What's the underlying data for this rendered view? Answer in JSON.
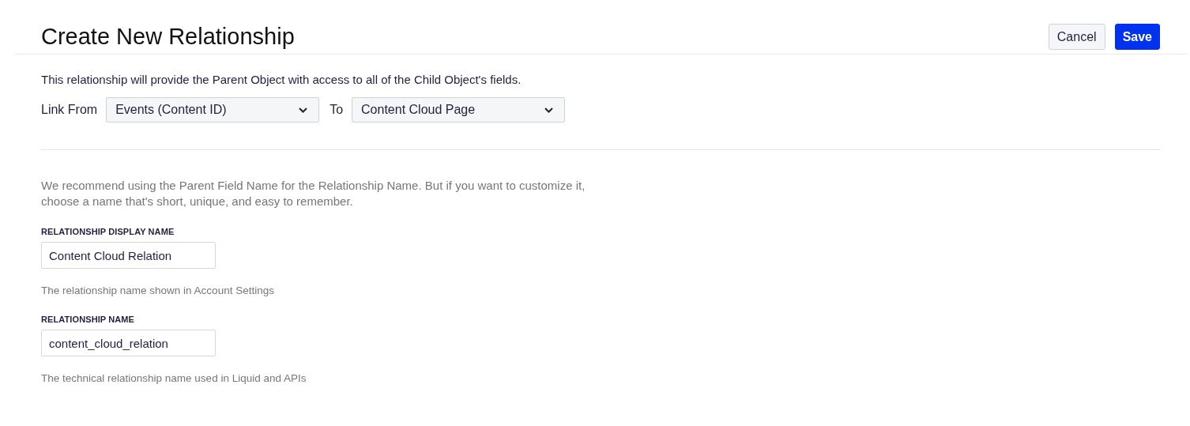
{
  "header": {
    "title": "Create New Relationship",
    "buttons": [
      {
        "label": "Cancel",
        "kind": "secondary"
      },
      {
        "label": "Save",
        "kind": "primary"
      }
    ]
  },
  "intro": "This relationship will provide the Parent Object with access to all of the Child Object's fields.",
  "link": {
    "from_label": "Link From",
    "from_value": "Events (Content ID)",
    "to_label": "To",
    "to_value": "Content Cloud Page"
  },
  "recommendation": "We recommend using the Parent Field Name for the Relationship Name. But if you want to customize it, choose a name that's short, unique, and easy to remember.",
  "fields": [
    {
      "label": "RELATIONSHIP DISPLAY NAME",
      "value": "Content Cloud Relation",
      "help": "The relationship name shown in Account Settings"
    },
    {
      "label": "RELATIONSHIP NAME",
      "value": "content_cloud_relation",
      "help": "The technical relationship name used in Liquid and APIs"
    }
  ]
}
